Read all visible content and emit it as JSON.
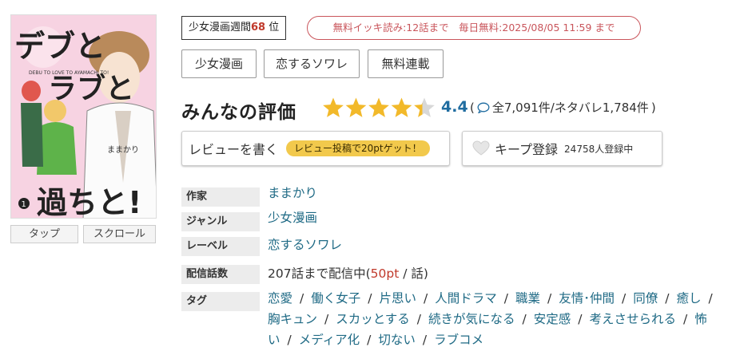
{
  "cover": {
    "title_lines": [
      "デブと",
      "ラブと",
      "過ちと!"
    ],
    "romaji": "DEBU TO LOVE TO AYAMACHI TO!",
    "author_caption": "ままかり",
    "volume": "1"
  },
  "view_modes": {
    "tap": "タップ",
    "scroll": "スクロール"
  },
  "ranking": {
    "label": "少女漫画週間",
    "rank": "68",
    "suffix": "位"
  },
  "free_notice": "無料イッキ読み:12話まで　毎日無料:2025/08/05 11:59 まで",
  "categories": [
    "少女漫画",
    "恋するソワレ",
    "無料連載"
  ],
  "rating": {
    "title": "みんなの評価",
    "score": "4.4",
    "stars_value": 4.4,
    "stars_max": 5,
    "counts_prefix": "(",
    "counts_text": "全7,091件/ネタバレ1,784件",
    "counts_suffix": ")"
  },
  "review_button": {
    "label": "レビューを書く",
    "promo": "レビュー投稿で20ptゲット！"
  },
  "keep_button": {
    "label": "キープ登録",
    "count": "24758人登録中"
  },
  "info": {
    "author_label": "作家",
    "author": "ままかり",
    "genre_label": "ジャンル",
    "genre": "少女漫画",
    "label_label": "レーベル",
    "label": "恋するソワレ",
    "episodes_label": "配信話数",
    "episodes_prefix": "207話まで配信中(",
    "episodes_price": "50pt",
    "episodes_suffix": " / 話)",
    "tags_label": "タグ",
    "tags": [
      "恋愛",
      "働く女子",
      "片思い",
      "人間ドラマ",
      "職業",
      "友情･仲間",
      "同僚",
      "癒し",
      "胸キュン",
      "スカッとする",
      "続きが気になる",
      "安定感",
      "考えさせられる",
      "怖い",
      "メディア化",
      "切ない",
      "ラブコメ"
    ]
  },
  "colors": {
    "star": "#f2b92a",
    "star_empty": "#d8d8d8",
    "score": "#1f6ca0",
    "link": "#1f6a85",
    "accent_red": "#c9555b",
    "promo_pill": "#f2c94c"
  }
}
